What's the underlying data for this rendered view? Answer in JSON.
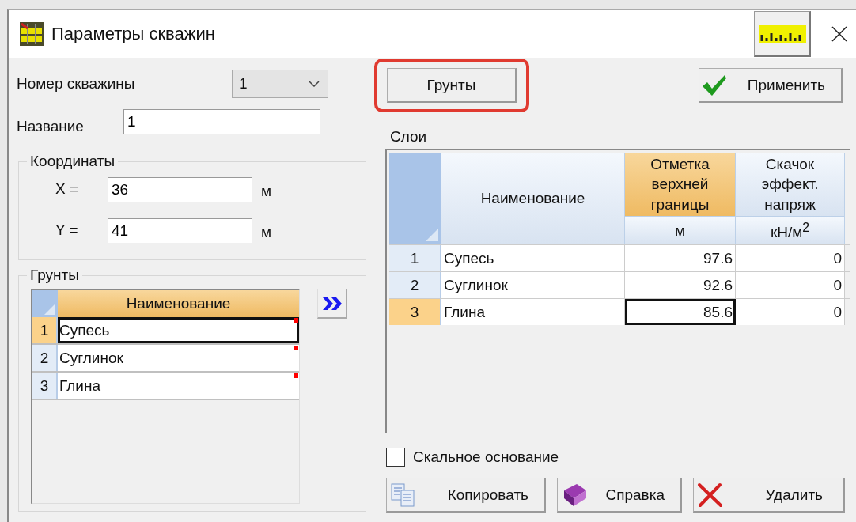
{
  "window": {
    "title": "Параметры скважин"
  },
  "well_number": {
    "label": "Номер скважины",
    "value": "1"
  },
  "name": {
    "label": "Название",
    "value": "1"
  },
  "coordinates": {
    "title": "Координаты",
    "fields": [
      {
        "label": "X =",
        "value": "36",
        "unit": "м"
      },
      {
        "label": "Y =",
        "value": "41",
        "unit": "м"
      }
    ]
  },
  "soils": {
    "title": "Грунты",
    "column": "Наименование",
    "rows": [
      {
        "num": "1",
        "name": "Супесь",
        "selected": true
      },
      {
        "num": "2",
        "name": "Суглинок",
        "selected": false
      },
      {
        "num": "3",
        "name": "Глина",
        "selected": false
      }
    ]
  },
  "soils_button": {
    "label": "Грунты",
    "highlighted": true
  },
  "apply_button": {
    "label": "Применить"
  },
  "layers": {
    "title": "Слои",
    "columns": [
      {
        "header": "Наименование",
        "selected": false
      },
      {
        "header": "Отметка верхней границы",
        "unit": "м",
        "selected": true
      },
      {
        "header": "Скачок эффект. напряж",
        "unit": "кН/м$^{2}$",
        "selected": false
      }
    ],
    "rows": [
      {
        "num": "1",
        "name": "Супесь",
        "elevation": "97.6",
        "jump": "0",
        "selected": false
      },
      {
        "num": "2",
        "name": "Суглинок",
        "elevation": "92.6",
        "jump": "0",
        "selected": false
      },
      {
        "num": "3",
        "name": "Глина",
        "elevation": "85.6",
        "jump": "0",
        "selected": true
      }
    ]
  },
  "rock_base": {
    "label": "Скальное основание",
    "checked": false
  },
  "buttons": [
    {
      "kind": "copy",
      "label": "Копировать"
    },
    {
      "kind": "help",
      "label": "Справка"
    },
    {
      "kind": "delete",
      "label": "Удалить"
    }
  ]
}
